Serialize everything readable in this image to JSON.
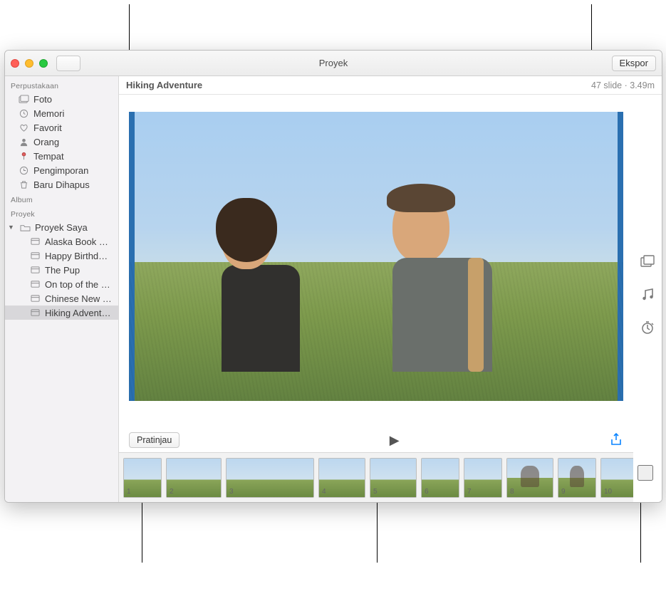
{
  "window": {
    "title": "Proyek",
    "export_label": "Ekspor"
  },
  "sidebar": {
    "section_library": "Perpustakaan",
    "library_items": [
      {
        "label": "Foto",
        "icon": "photo-stack-icon"
      },
      {
        "label": "Memori",
        "icon": "clock-icon"
      },
      {
        "label": "Favorit",
        "icon": "heart-icon"
      },
      {
        "label": "Orang",
        "icon": "person-icon"
      },
      {
        "label": "Tempat",
        "icon": "pin-icon"
      },
      {
        "label": "Pengimporan",
        "icon": "history-icon"
      },
      {
        "label": "Baru Dihapus",
        "icon": "trash-icon"
      }
    ],
    "section_album": "Album",
    "section_projects": "Proyek",
    "my_projects_label": "Proyek Saya",
    "projects": [
      {
        "label": "Alaska Book Proj…"
      },
      {
        "label": "Happy Birthday…"
      },
      {
        "label": "The Pup"
      },
      {
        "label": "On top of the W…"
      },
      {
        "label": "Chinese New Year"
      },
      {
        "label": "Hiking Adventure",
        "selected": true
      }
    ]
  },
  "project": {
    "title": "Hiking Adventure",
    "slide_count_label": "47 slide",
    "duration_label": "3.49m",
    "preview_label": "Pratinjau"
  },
  "filmstrip": {
    "thumbs": [
      {
        "n": "1"
      },
      {
        "n": "2"
      },
      {
        "n": "3"
      },
      {
        "n": "4"
      },
      {
        "n": "5"
      },
      {
        "n": "6"
      },
      {
        "n": "7"
      },
      {
        "n": "8"
      },
      {
        "n": "9"
      },
      {
        "n": "10"
      }
    ]
  },
  "right_tools": {
    "theme_label": "theme",
    "music_label": "music",
    "duration_label": "duration"
  }
}
